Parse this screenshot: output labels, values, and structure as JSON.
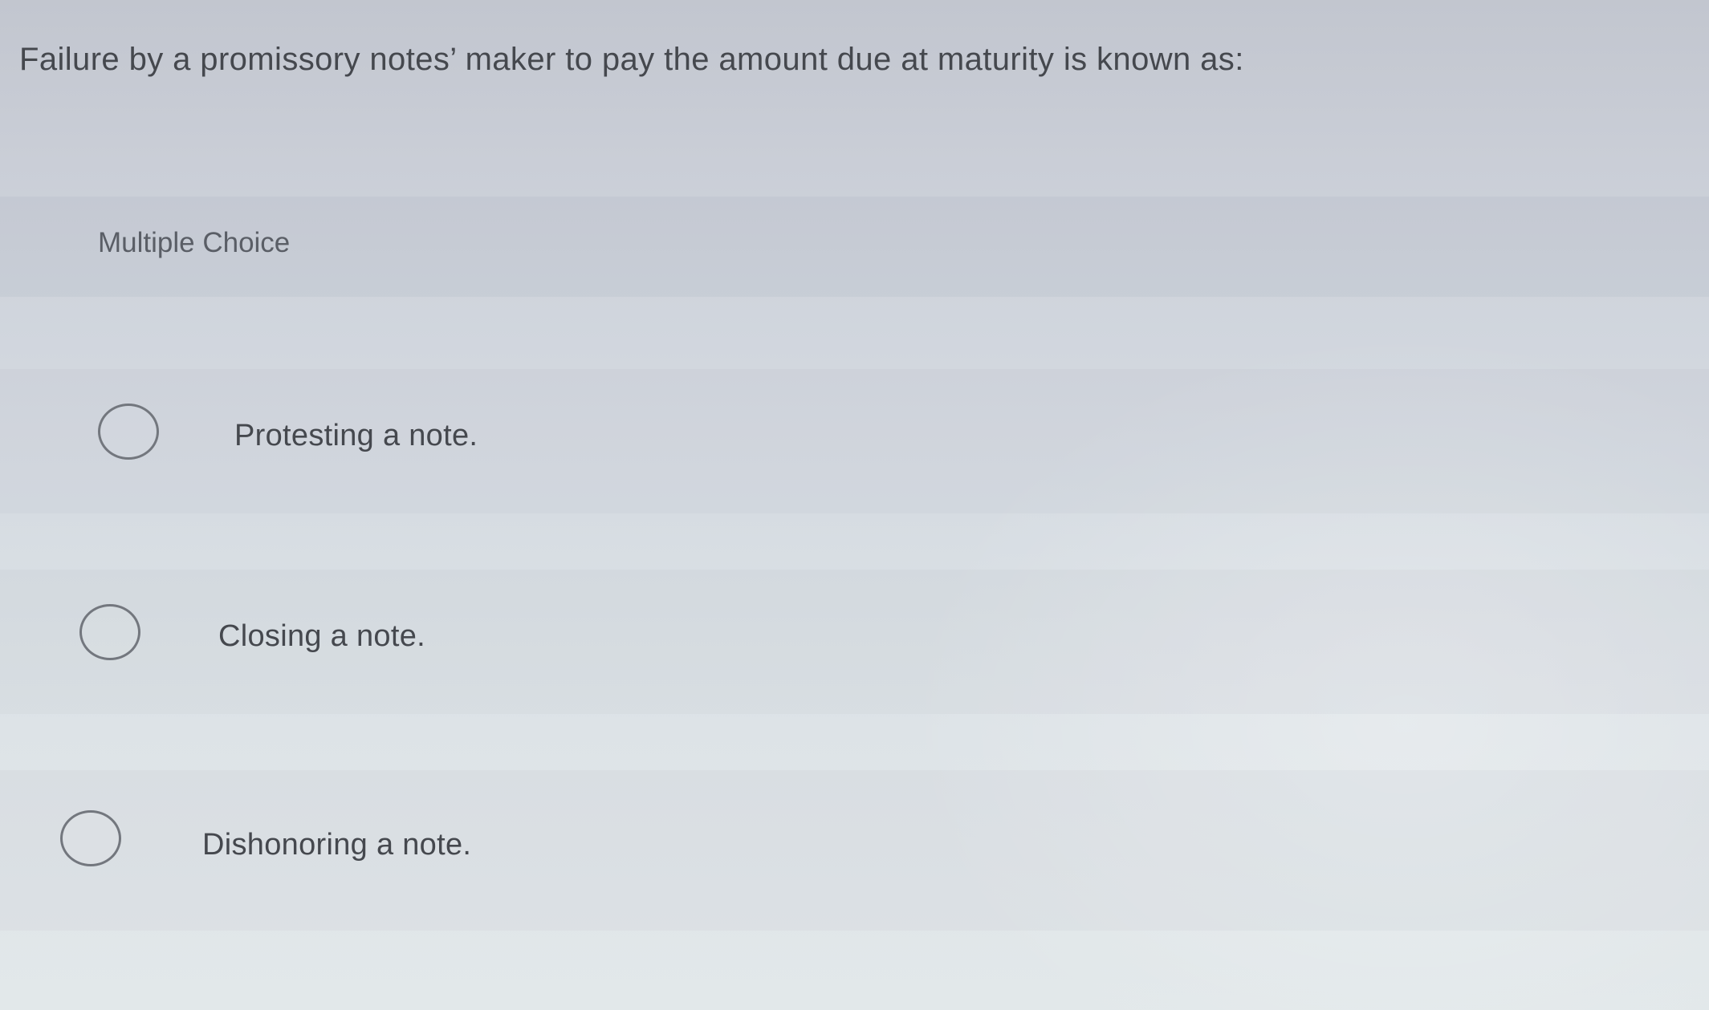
{
  "question": {
    "text": "Failure by a promissory notes’ maker to pay the amount due at maturity is known as:"
  },
  "answer_section": {
    "type_label": "Multiple Choice",
    "options": [
      {
        "label": "Protesting a note.",
        "selected": false
      },
      {
        "label": "Closing a note.",
        "selected": false
      },
      {
        "label": "Dishonoring a note.",
        "selected": false
      }
    ]
  },
  "colors": {
    "text": "#45484e",
    "radio_border": "#73777e",
    "background": "#d2d7df"
  },
  "icons": {
    "radio": "radio-unselected-icon"
  }
}
